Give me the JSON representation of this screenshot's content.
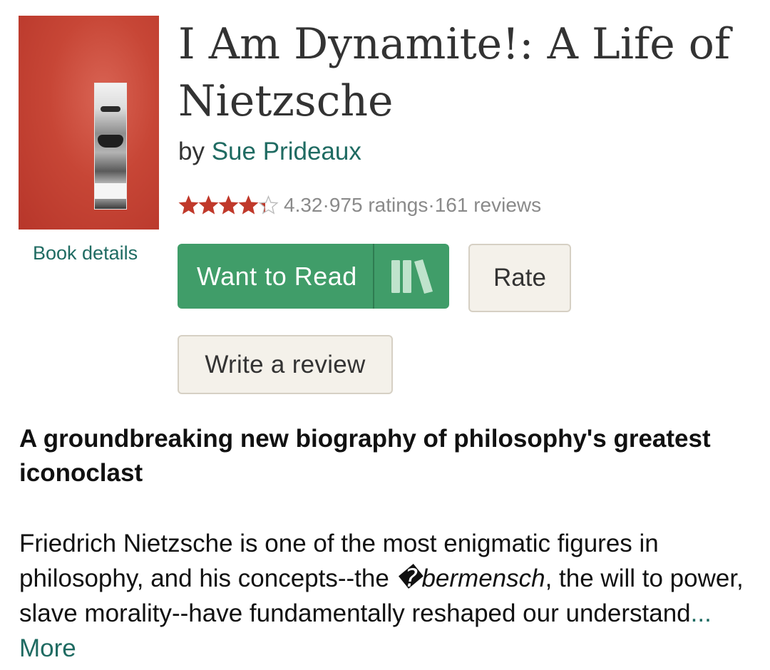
{
  "cover": {
    "background_color": "#c23a2e"
  },
  "book_details_link": "Book details",
  "book": {
    "title": "I Am Dynamite!: A Life of Nietzsche",
    "by_prefix": "by ",
    "author": "Sue Prideaux"
  },
  "rating": {
    "stars_value": 4.32,
    "stars_max": 5,
    "average": "4.32",
    "separator1": " · ",
    "ratings": "975 ratings",
    "separator2": " · ",
    "reviews": "161 reviews",
    "star_color": "#c0392b",
    "star_empty_color": "#bbbbbb"
  },
  "actions": {
    "want_to_read": "Want to Read",
    "shelf_icon": "bookshelf-icon",
    "rate": "Rate",
    "write_review": "Write a review"
  },
  "description": {
    "headline": "A groundbreaking new biography of philosophy's greatest iconoclast",
    "part1": "Friedrich Nietzsche is one of the most enigmatic figures in philosophy, and his concepts--the ",
    "italic_word": "�bermensch",
    "part2": ", the will to power, slave morality--have fundamentally reshaped our understand",
    "more_link": "... More"
  },
  "colors": {
    "accent_green": "#409d69",
    "link_teal": "#1f6b62",
    "button_beige": "#f4f1ea"
  }
}
